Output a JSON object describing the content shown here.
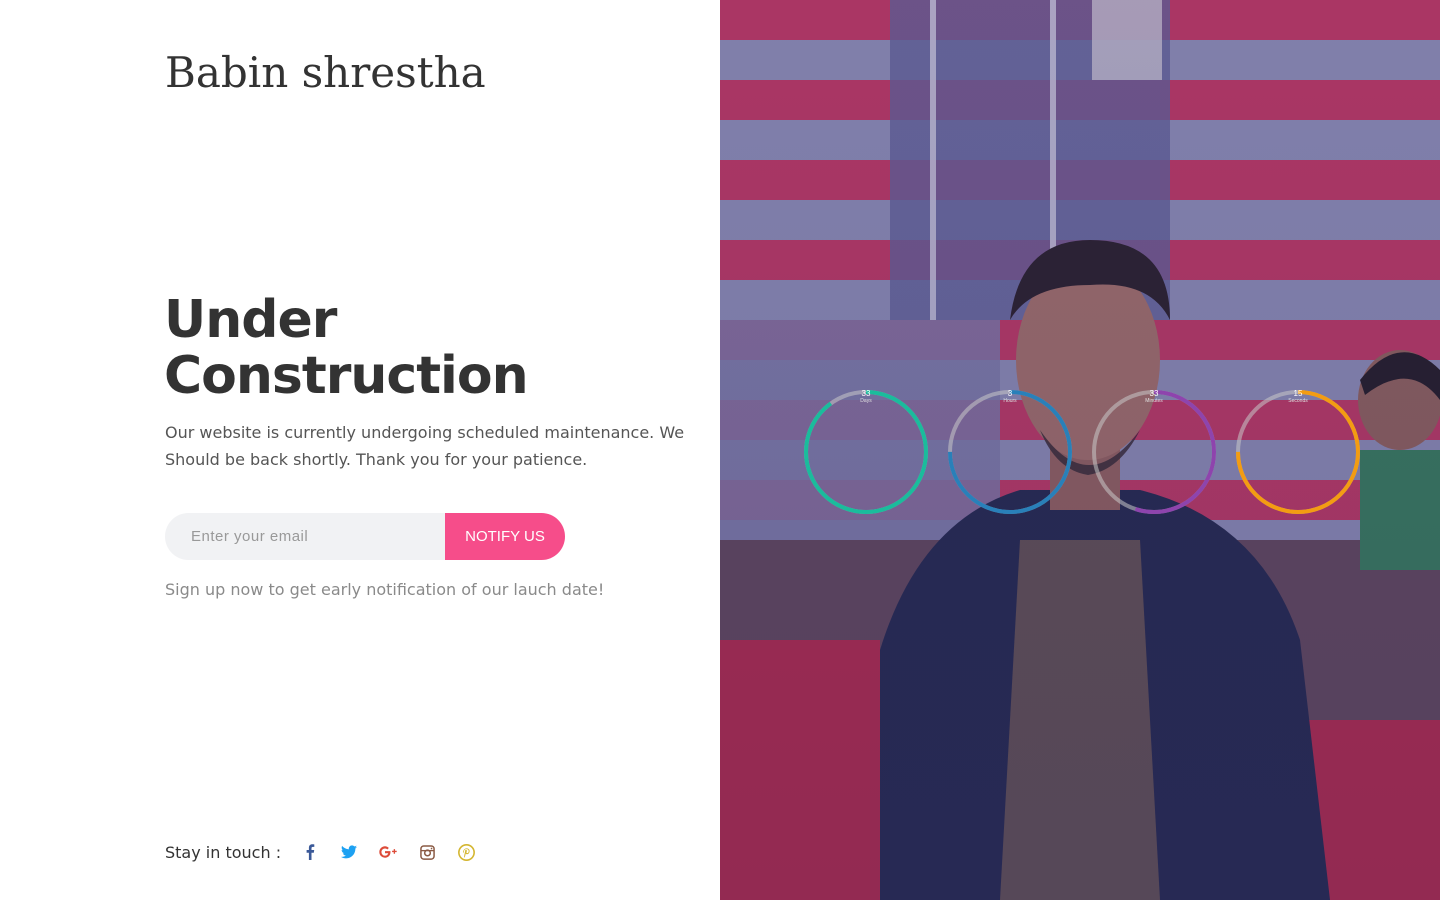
{
  "brand": {
    "name": "Babin shrestha"
  },
  "hero": {
    "title_line1": "Under",
    "title_line2": "Construction",
    "description": "Our website is currently undergoing scheduled maintenance. We Should be back shortly. Thank you for your patience."
  },
  "subscribe": {
    "email_placeholder": "Enter your email",
    "button_label": "NOTIFY US",
    "note": "Sign up now to get early notification of our lauch date!"
  },
  "social": {
    "label": "Stay in touch :",
    "links": [
      {
        "icon": "facebook-icon",
        "color": "#3b5998"
      },
      {
        "icon": "twitter-icon",
        "color": "#1da1f2"
      },
      {
        "icon": "google-plus-icon",
        "color": "#dd4b39"
      },
      {
        "icon": "instagram-icon",
        "color": "#8a5a44"
      },
      {
        "icon": "pinterest-icon",
        "color": "#d4b630"
      }
    ]
  },
  "countdown": {
    "items": [
      {
        "value": "33",
        "unit": "Days",
        "color": "#1abc9c",
        "progress": 0.9
      },
      {
        "value": "3",
        "unit": "Hours",
        "color": "#2980b9",
        "progress": 0.75
      },
      {
        "value": "33",
        "unit": "Minutes",
        "color": "#8e44ad",
        "progress": 0.55
      },
      {
        "value": "15",
        "unit": "Seconds",
        "color": "#f39c12",
        "progress": 0.75
      }
    ]
  },
  "colors": {
    "accent": "#f64d8a",
    "text_dark": "#333333",
    "text_muted": "#8a8a8a",
    "input_bg": "#f1f2f4"
  }
}
